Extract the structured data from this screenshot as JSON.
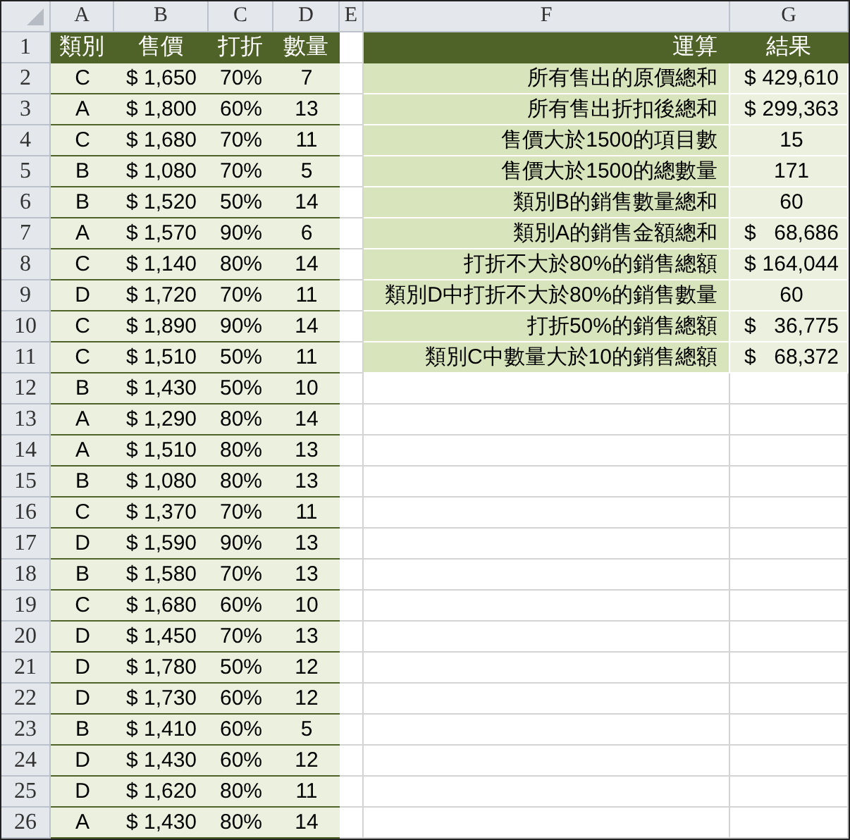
{
  "column_headers": [
    "A",
    "B",
    "C",
    "D",
    "E",
    "F",
    "G"
  ],
  "row_numbers": [
    "1",
    "2",
    "3",
    "4",
    "5",
    "6",
    "7",
    "8",
    "9",
    "10",
    "11",
    "12",
    "13",
    "14",
    "15",
    "16",
    "17",
    "18",
    "19",
    "20",
    "21",
    "22",
    "23",
    "24",
    "25",
    "26"
  ],
  "sales_table": {
    "columns": [
      "類別",
      "售價",
      "打折",
      "數量"
    ],
    "rows": [
      [
        "C",
        "$ 1,650",
        "70%",
        "7"
      ],
      [
        "A",
        "$ 1,800",
        "60%",
        "13"
      ],
      [
        "C",
        "$ 1,680",
        "70%",
        "11"
      ],
      [
        "B",
        "$ 1,080",
        "70%",
        "5"
      ],
      [
        "B",
        "$ 1,520",
        "50%",
        "14"
      ],
      [
        "A",
        "$ 1,570",
        "90%",
        "6"
      ],
      [
        "C",
        "$ 1,140",
        "80%",
        "14"
      ],
      [
        "D",
        "$ 1,720",
        "70%",
        "11"
      ],
      [
        "C",
        "$ 1,890",
        "90%",
        "14"
      ],
      [
        "C",
        "$ 1,510",
        "50%",
        "11"
      ],
      [
        "B",
        "$ 1,430",
        "50%",
        "10"
      ],
      [
        "A",
        "$ 1,290",
        "80%",
        "14"
      ],
      [
        "A",
        "$ 1,510",
        "80%",
        "13"
      ],
      [
        "B",
        "$ 1,080",
        "80%",
        "13"
      ],
      [
        "C",
        "$ 1,370",
        "70%",
        "11"
      ],
      [
        "D",
        "$ 1,590",
        "90%",
        "13"
      ],
      [
        "B",
        "$ 1,580",
        "70%",
        "13"
      ],
      [
        "C",
        "$ 1,680",
        "60%",
        "10"
      ],
      [
        "D",
        "$ 1,450",
        "70%",
        "13"
      ],
      [
        "D",
        "$ 1,780",
        "50%",
        "12"
      ],
      [
        "D",
        "$ 1,730",
        "60%",
        "12"
      ],
      [
        "B",
        "$ 1,410",
        "60%",
        "5"
      ],
      [
        "D",
        "$ 1,430",
        "60%",
        "12"
      ],
      [
        "D",
        "$ 1,620",
        "80%",
        "11"
      ],
      [
        "A",
        "$ 1,430",
        "80%",
        "14"
      ]
    ]
  },
  "calc_table": {
    "columns": [
      "運算",
      "結果"
    ],
    "rows": [
      {
        "label": "所有售出的原價總和",
        "kind": "currency",
        "symbol": "$",
        "amount": "429,610"
      },
      {
        "label": "所有售出折扣後總和",
        "kind": "currency",
        "symbol": "$",
        "amount": "299,363"
      },
      {
        "label": "售價大於1500的項目數",
        "kind": "number",
        "amount": "15"
      },
      {
        "label": "售價大於1500的總數量",
        "kind": "number",
        "amount": "171"
      },
      {
        "label": "類別B的銷售數量總和",
        "kind": "number",
        "amount": "60"
      },
      {
        "label": "類別A的銷售金額總和",
        "kind": "currency",
        "symbol": "$",
        "amount": "68,686"
      },
      {
        "label": "打折不大於80%的銷售總額",
        "kind": "currency",
        "symbol": "$",
        "amount": "164,044"
      },
      {
        "label": "類別D中打折不大於80%的銷售數量",
        "kind": "number",
        "amount": "60"
      },
      {
        "label": "打折50%的銷售總額",
        "kind": "currency",
        "symbol": "$",
        "amount": "36,775"
      },
      {
        "label": "類別C中數量大於10的銷售總額",
        "kind": "currency",
        "symbol": "$",
        "amount": "68,372"
      }
    ]
  }
}
